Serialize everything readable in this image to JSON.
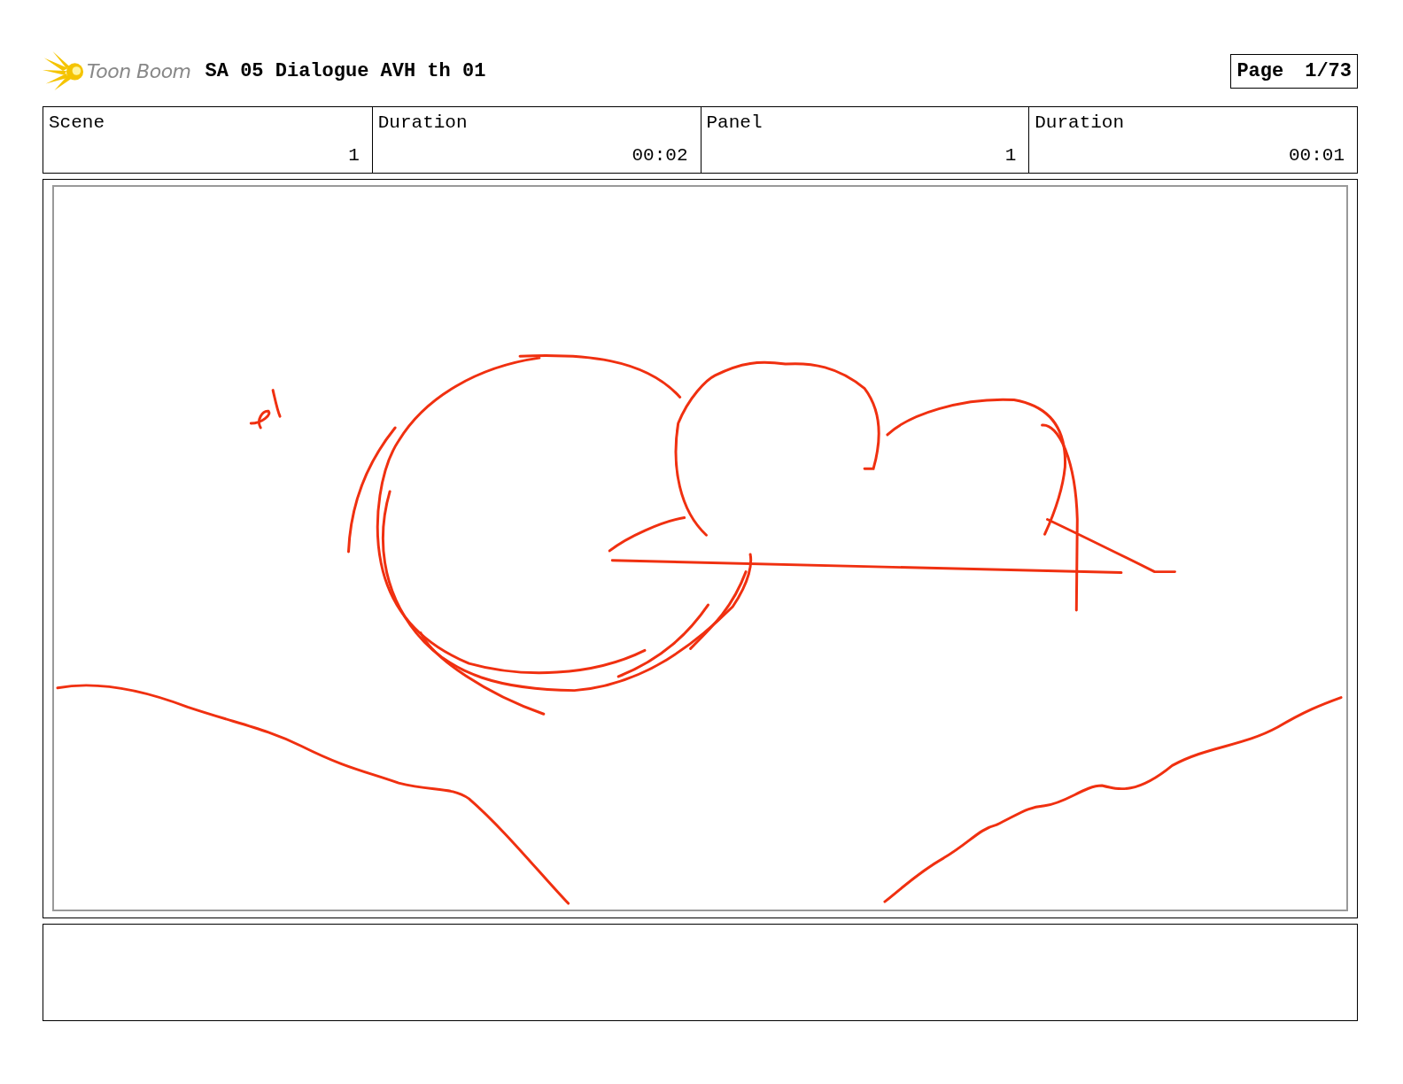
{
  "header": {
    "logo_text": "Toon Boom",
    "title": "SA 05 Dialogue AVH th 01",
    "page_label": "Page",
    "page_number": "1/73"
  },
  "fields": [
    {
      "label": "Scene",
      "value": "1"
    },
    {
      "label": "Duration",
      "value": "00:02"
    },
    {
      "label": "Panel",
      "value": "1"
    },
    {
      "label": "Duration",
      "value": "00:01"
    }
  ],
  "panel": {
    "kind": "sketch"
  }
}
